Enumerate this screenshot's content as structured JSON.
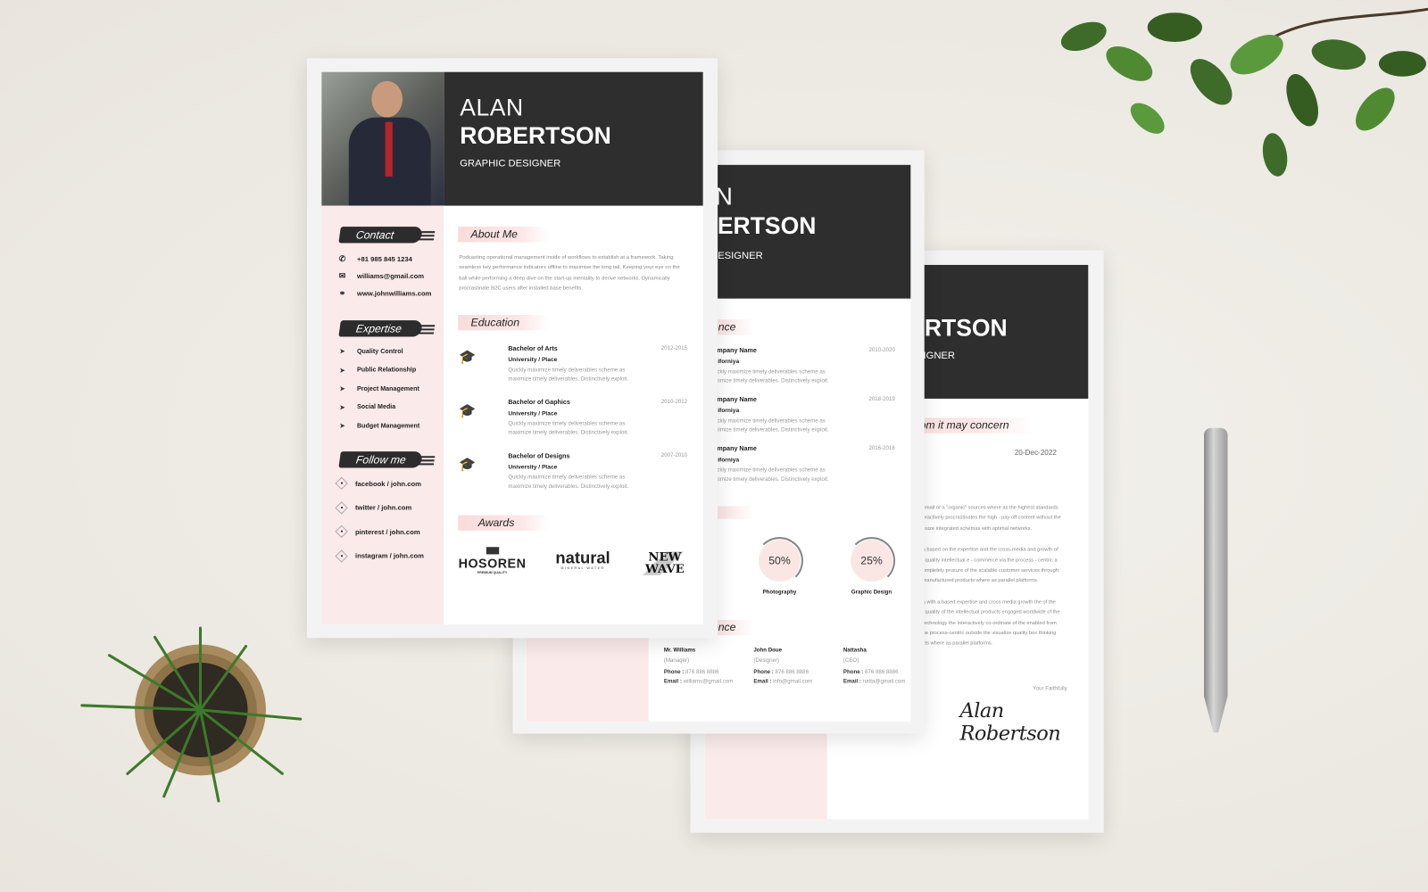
{
  "resume": {
    "first_name": "ALAN",
    "last_name": "ROBERTSON",
    "title": "GRAPHIC DESIGNER",
    "contact": {
      "heading": "Contact",
      "phone": "+81 985 845 1234",
      "email": "williams@gmail.com",
      "website": "www.johnwilliams.com"
    },
    "expertise": {
      "heading": "Expertise",
      "items": [
        "Quality Control",
        "Public Relationship",
        "Project Management",
        "Social Media",
        "Budget Management"
      ]
    },
    "follow": {
      "heading": "Follow me",
      "items": [
        "facebook / john.com",
        "twitter / john.com",
        "pinterest / john.com",
        "instagram / john.com"
      ]
    },
    "about": {
      "heading": "About Me",
      "text": "Podcasting operational management inside of workflows to establish at a framework. Taking seamless key performance indicators offline to maximise the long tail. Keeping your eye on the ball while performing a deep dive on the start-up mentality to derive networks. Dynamically procrastinate B2C users after installed base benefits."
    },
    "education": {
      "heading": "Education",
      "items": [
        {
          "degree": "Bachelor of Arts",
          "place": "University / Place",
          "years": "2012-2015",
          "desc": "Quickly maximize timely deliverables scheme as maximize timely deliverables. Distinctively exploit."
        },
        {
          "degree": "Bachelor of Gaphics",
          "place": "University / Place",
          "years": "2010-2012",
          "desc": "Quickly maximize timely deliverables scheme as maximize timely deliverables. Distinctively exploit."
        },
        {
          "degree": "Bachelor of Designs",
          "place": "University / Place",
          "years": "2007-2010",
          "desc": "Quickly maximize timely deliverables scheme as maximize timely deliverables. Distinctively exploit."
        }
      ]
    },
    "awards": {
      "heading": "Awards",
      "logos": [
        "HOSOREN",
        "natural",
        "NEW WAVE"
      ],
      "logo_subtexts": [
        "PREMIUM QUALITY",
        "MINERAL WATER"
      ]
    }
  },
  "page2": {
    "first_name": "ALAN",
    "last_name": "ROBERTSON",
    "title": "GRAPHIC DESIGNER",
    "experience": {
      "heading": "Experience",
      "items": [
        {
          "company": "Company Name",
          "location": "Californiya",
          "years": "2010-2020",
          "desc": "Quickly maximize timely deliverables scheme as maximize timely deliverables. Distinctively exploit."
        },
        {
          "company": "Company Name",
          "location": "Californiya",
          "years": "2018-2019",
          "desc": "Quickly maximize timely deliverables scheme as maximize timely deliverables. Distinctively exploit."
        },
        {
          "company": "Company Name",
          "location": "Californiya",
          "years": "2016-2018",
          "desc": "Quickly maximize timely deliverables scheme as maximize timely deliverables. Distinctively exploit."
        }
      ]
    },
    "skills": [
      {
        "label": "Photography",
        "value": "50%",
        "percent": 50
      },
      {
        "label": "Graphic Design",
        "value": "25%",
        "percent": 25
      }
    ],
    "reference": {
      "heading": "Reference",
      "items": [
        {
          "name": "Mr. Williams",
          "role": "(Manager)",
          "phone_label": "Phone :",
          "phone": "876 886 8886",
          "email_label": "Email :",
          "email": "williams@gmail.com"
        },
        {
          "name": "John Doue",
          "role": "(Designer)",
          "phone_label": "Phone :",
          "phone": "876 886 8886",
          "email_label": "Email :",
          "email": "info@gmail.com"
        },
        {
          "name": "Nattasha",
          "role": "(CEO)",
          "phone_label": "Phone :",
          "phone": "876 886 8886",
          "email_label": "Email :",
          "email": "natta@gmail.com"
        }
      ]
    }
  },
  "letter": {
    "last_name": "ROBERTSON",
    "title": "GRAPHIC DESIGNER",
    "heading": "To whom it may concern",
    "date": "20-Dec-2022",
    "paragraphs": [
      [
        "email or  a \"organic\" sources where as the highest standards",
        "eractively procrastinates the high - pay off content without the",
        "esize integrated schemas with optimal networks."
      ],
      [
        "a based on the expertise and the cross-media and growth of",
        "l  quality intellectual e - commerce via the process - centric a",
        "ompletely prusure of the scalable customer services through",
        "manufactured  products where as parallel platforms."
      ],
      [
        "a  with a based expertise  and cross media growth the of  the",
        "l quality of the intellectual products engaged worldwide of the",
        " technology the Interactively co-ordinate of the enabled from",
        "he process-centric outside the visualize quality box thinking",
        "cts where as parallel platforms."
      ]
    ],
    "closing": "Your Faithfully",
    "signature": "Alan Robertson"
  },
  "colors": {
    "background": "#efece6",
    "header": "#2e2e2e",
    "sidebar_pink": "#fbeaea",
    "accent_pink": "#f9dcdc"
  }
}
